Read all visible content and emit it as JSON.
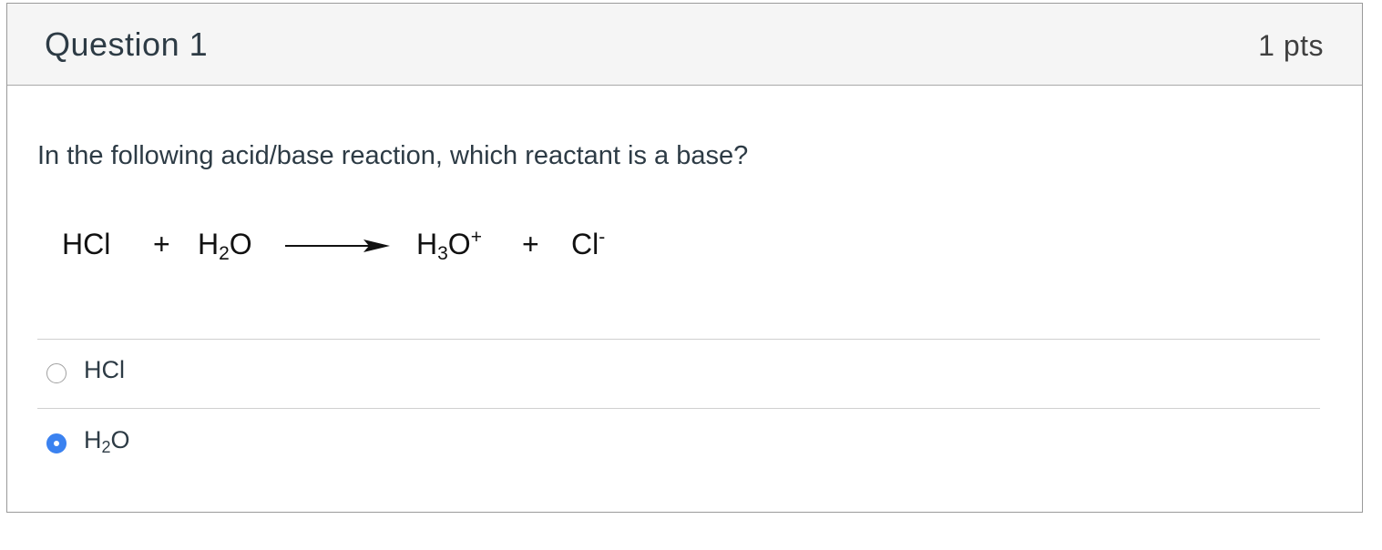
{
  "question": {
    "title": "Question 1",
    "points": "1 pts",
    "prompt": "In the following acid/base reaction, which reactant is a base?",
    "reaction": {
      "reactant1": "HCl",
      "plus1": "+",
      "reactant2_base": "H",
      "reactant2_sub": "2",
      "reactant2_tail": "O",
      "product1_base": "H",
      "product1_sub": "3",
      "product1_tail": "O",
      "product1_sup": "+",
      "plus2": "+",
      "product2": "Cl",
      "product2_sup": "-"
    },
    "answers": [
      {
        "label": "HCl",
        "selected": false
      },
      {
        "label_base": "H",
        "label_sub": "2",
        "label_tail": "O",
        "selected": true
      }
    ]
  },
  "colors": {
    "header_bg": "#f5f5f5",
    "selected_radio": "#3b82f0",
    "text": "#2d3b45"
  }
}
